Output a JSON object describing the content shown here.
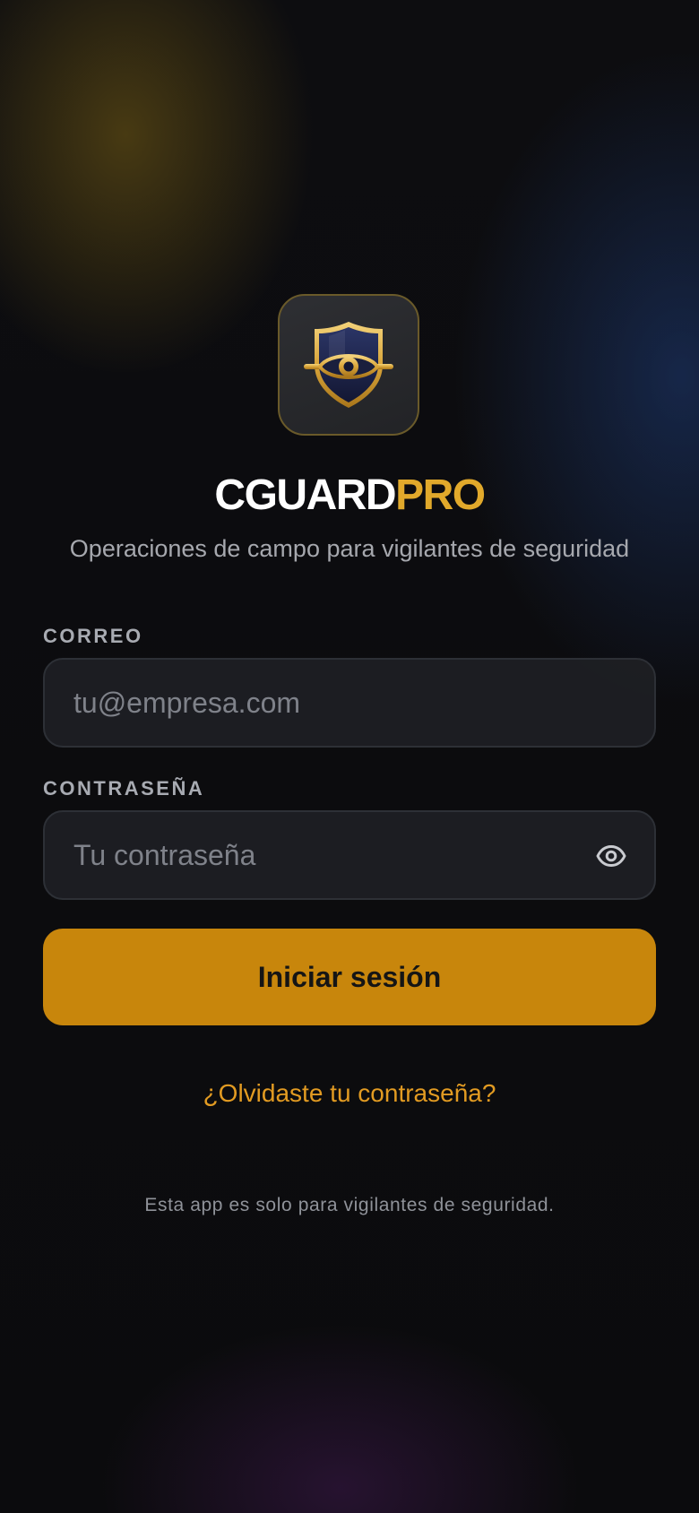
{
  "brand": {
    "title_part1": "CGUARD",
    "title_part2": "PRO",
    "subtitle": "Operaciones de campo para vigilantes de seguridad",
    "logo_icon": "shield-eye-icon",
    "accent_color": "#e1a92b"
  },
  "login_form": {
    "email": {
      "label": "CORREO",
      "value": "",
      "placeholder": "tu@empresa.com"
    },
    "password": {
      "label": "CONTRASEÑA",
      "value": "",
      "placeholder": "Tu contraseña",
      "toggle_icon": "eye-icon"
    },
    "submit_label": "Iniciar sesión",
    "submit_color": "#c8860c",
    "forgot_password": "¿Olvidaste tu contraseña?"
  },
  "footer": {
    "note": "Esta app es solo para vigilantes de seguridad."
  }
}
